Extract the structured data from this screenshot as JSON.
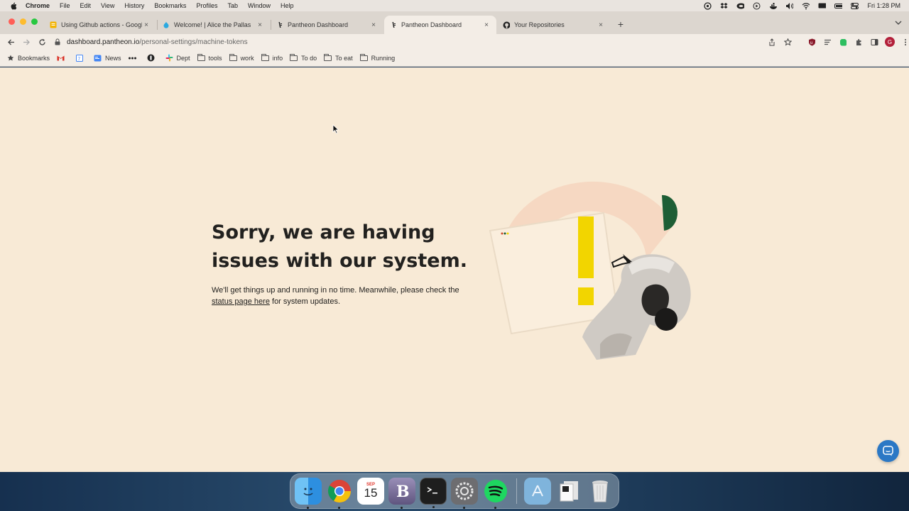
{
  "menubar": {
    "app_name": "Chrome",
    "items": [
      "File",
      "Edit",
      "View",
      "History",
      "Bookmarks",
      "Profiles",
      "Tab",
      "Window",
      "Help"
    ],
    "clock": "Fri 1:28 PM"
  },
  "tabs": [
    {
      "title": "Using Github actions - Google",
      "favicon": "google-docs-icon",
      "close": "×"
    },
    {
      "title": "Welcome! | Alice the Pallas",
      "favicon": "drupal-icon",
      "close": "×"
    },
    {
      "title": "Pantheon Dashboard",
      "favicon": "pantheon-icon",
      "close": "×"
    },
    {
      "title": "Pantheon Dashboard",
      "favicon": "pantheon-icon",
      "close": "×",
      "active": true
    },
    {
      "title": "Your Repositories",
      "favicon": "github-icon",
      "close": "×"
    }
  ],
  "newtab_label": "+",
  "address": {
    "host": "dashboard.pantheon.io",
    "path": "/personal-settings/machine-tokens"
  },
  "profile_initial": "G",
  "bookmarks": {
    "items": [
      {
        "label": "Bookmarks",
        "icon": "star-icon"
      },
      {
        "label": "",
        "icon": "gmail-icon"
      },
      {
        "label": "",
        "icon": "calendar-icon"
      },
      {
        "label": "News",
        "icon": "news-icon"
      },
      {
        "label": "",
        "icon": "dots-icon"
      },
      {
        "label": "",
        "icon": "circle-logo-icon"
      },
      {
        "label": "Dept",
        "icon": "slack-icon"
      },
      {
        "label": "tools",
        "icon": "folder-icon"
      },
      {
        "label": "work",
        "icon": "folder-icon"
      },
      {
        "label": "info",
        "icon": "folder-icon"
      },
      {
        "label": "To do",
        "icon": "folder-icon"
      },
      {
        "label": "To eat",
        "icon": "folder-icon"
      },
      {
        "label": "Running",
        "icon": "folder-icon"
      }
    ]
  },
  "error_page": {
    "headline": "Sorry, we are having issues with our system.",
    "body_before": "We'll get things up and running in no time. Meanwhile, please check the ",
    "link_text": "status page here",
    "body_after": " for system updates."
  },
  "dock": {
    "calendar_month": "SEP",
    "calendar_day": "15",
    "items": [
      "finder-icon",
      "chrome-icon",
      "calendar-icon",
      "bbedit-icon",
      "terminal-icon",
      "system-settings-icon",
      "spotify-icon",
      "appstore-folder-icon",
      "documents-icon",
      "trash-icon"
    ]
  },
  "colors": {
    "page_bg": "#f8ead6",
    "headline": "#22211f",
    "chat_button": "#2b78c5",
    "yellow_accent": "#f2d500",
    "green_accent": "#1e5e35"
  }
}
